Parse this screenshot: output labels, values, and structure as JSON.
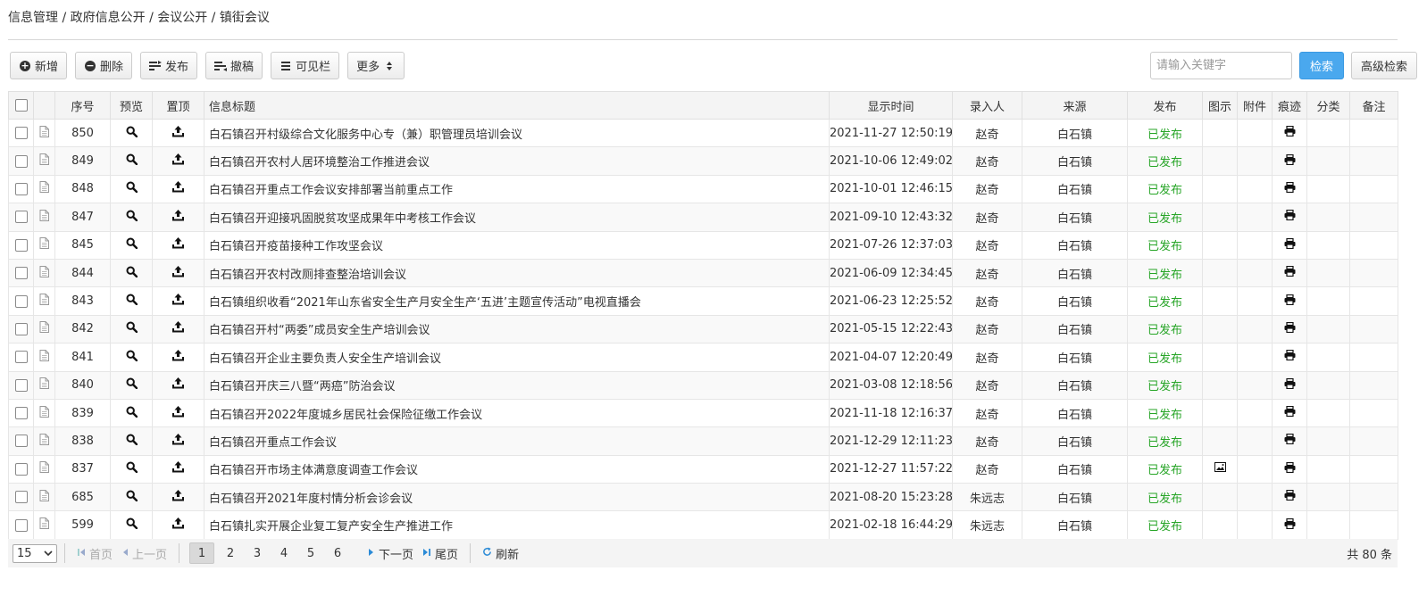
{
  "breadcrumb": "信息管理 / 政府信息公开 / 会议公开 / 镇街会议",
  "toolbar": {
    "add": "新增",
    "delete": "删除",
    "publish": "发布",
    "withdraw": "撤稿",
    "columns": "可见栏",
    "more": "更多"
  },
  "search": {
    "placeholder": "请输入关键字",
    "button": "检索",
    "advanced": "高级检索"
  },
  "table": {
    "headers": {
      "seq": "序号",
      "preview": "预览",
      "top": "置顶",
      "title": "信息标题",
      "time": "显示时间",
      "author": "录入人",
      "source": "来源",
      "publish": "发布",
      "image": "图示",
      "attach": "附件",
      "trace": "痕迹",
      "category": "分类",
      "note": "备注"
    },
    "rows": [
      {
        "seq": "850",
        "title": "白石镇召开村级综合文化服务中心专（兼）职管理员培训会议",
        "time": "2021-11-27 12:50:19",
        "author": "赵奇",
        "source": "白石镇",
        "status": "已发布",
        "has_image": false
      },
      {
        "seq": "849",
        "title": "白石镇召开农村人居环境整治工作推进会议",
        "time": "2021-10-06 12:49:02",
        "author": "赵奇",
        "source": "白石镇",
        "status": "已发布",
        "has_image": false
      },
      {
        "seq": "848",
        "title": "白石镇召开重点工作会议安排部署当前重点工作",
        "time": "2021-10-01 12:46:15",
        "author": "赵奇",
        "source": "白石镇",
        "status": "已发布",
        "has_image": false
      },
      {
        "seq": "847",
        "title": "白石镇召开迎接巩固脱贫攻坚成果年中考核工作会议",
        "time": "2021-09-10 12:43:32",
        "author": "赵奇",
        "source": "白石镇",
        "status": "已发布",
        "has_image": false
      },
      {
        "seq": "845",
        "title": "白石镇召开疫苗接种工作攻坚会议",
        "time": "2021-07-26 12:37:03",
        "author": "赵奇",
        "source": "白石镇",
        "status": "已发布",
        "has_image": false
      },
      {
        "seq": "844",
        "title": "白石镇召开农村改厕排查整治培训会议",
        "time": "2021-06-09 12:34:45",
        "author": "赵奇",
        "source": "白石镇",
        "status": "已发布",
        "has_image": false
      },
      {
        "seq": "843",
        "title": "白石镇组织收看“2021年山东省安全生产月安全生产‘五进’主题宣传活动”电视直播会",
        "time": "2021-06-23 12:25:52",
        "author": "赵奇",
        "source": "白石镇",
        "status": "已发布",
        "has_image": false
      },
      {
        "seq": "842",
        "title": "白石镇召开村“两委”成员安全生产培训会议",
        "time": "2021-05-15 12:22:43",
        "author": "赵奇",
        "source": "白石镇",
        "status": "已发布",
        "has_image": false
      },
      {
        "seq": "841",
        "title": "白石镇召开企业主要负责人安全生产培训会议",
        "time": "2021-04-07 12:20:49",
        "author": "赵奇",
        "source": "白石镇",
        "status": "已发布",
        "has_image": false
      },
      {
        "seq": "840",
        "title": "白石镇召开庆三八暨“两癌”防治会议",
        "time": "2021-03-08 12:18:56",
        "author": "赵奇",
        "source": "白石镇",
        "status": "已发布",
        "has_image": false
      },
      {
        "seq": "839",
        "title": "白石镇召开2022年度城乡居民社会保险征缴工作会议",
        "time": "2021-11-18 12:16:37",
        "author": "赵奇",
        "source": "白石镇",
        "status": "已发布",
        "has_image": false
      },
      {
        "seq": "838",
        "title": "白石镇召开重点工作会议",
        "time": "2021-12-29 12:11:23",
        "author": "赵奇",
        "source": "白石镇",
        "status": "已发布",
        "has_image": false
      },
      {
        "seq": "837",
        "title": "白石镇召开市场主体满意度调查工作会议",
        "time": "2021-12-27 11:57:22",
        "author": "赵奇",
        "source": "白石镇",
        "status": "已发布",
        "has_image": true
      },
      {
        "seq": "685",
        "title": "白石镇召开2021年度村情分析会诊会议",
        "time": "2021-08-20 15:23:28",
        "author": "朱远志",
        "source": "白石镇",
        "status": "已发布",
        "has_image": false
      },
      {
        "seq": "599",
        "title": "白石镇扎实开展企业复工复产安全生产推进工作",
        "time": "2021-02-18 16:44:29",
        "author": "朱远志",
        "source": "白石镇",
        "status": "已发布",
        "has_image": false
      }
    ]
  },
  "pager": {
    "page_size": "15",
    "first": "首页",
    "prev": "上一页",
    "pages": [
      "1",
      "2",
      "3",
      "4",
      "5",
      "6"
    ],
    "current": "1",
    "next": "下一页",
    "last": "尾页",
    "refresh": "刷新",
    "total": "共 80 条"
  },
  "colors": {
    "primary": "#4aa8ee",
    "published": "#27a527",
    "header_bg": "#f4f4f4"
  }
}
